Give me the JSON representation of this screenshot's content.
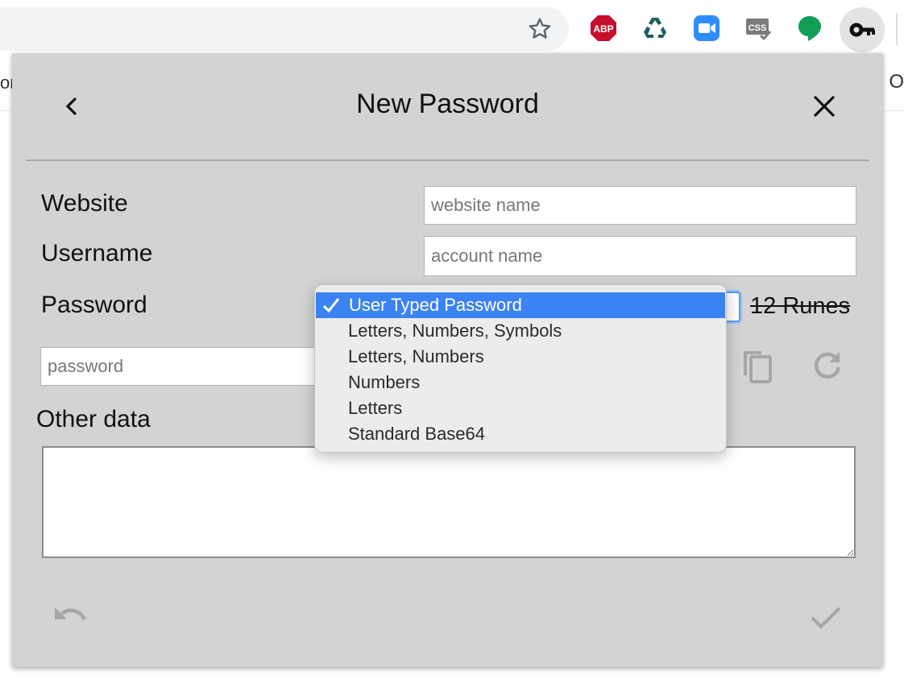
{
  "browser": {
    "extensions": [
      {
        "name": "AdBlock Plus",
        "label": "ABP",
        "icon": "abp-icon"
      },
      {
        "name": "recycle",
        "icon": "recycle-icon"
      },
      {
        "name": "zoom",
        "icon": "zoom-icon"
      },
      {
        "name": "css",
        "label": "CSS",
        "icon": "css-icon"
      },
      {
        "name": "chat",
        "icon": "chat-bubble-icon"
      },
      {
        "name": "key",
        "icon": "key-icon"
      }
    ],
    "page_left_text": "on",
    "page_right_text": "O"
  },
  "dialog": {
    "title": "New Password",
    "website": {
      "label": "Website",
      "placeholder": "website name"
    },
    "username": {
      "label": "Username",
      "placeholder": "account name"
    },
    "password": {
      "label": "Password",
      "placeholder": "password",
      "runes_text": "12 Runes"
    },
    "other": {
      "label": "Other data"
    }
  },
  "dropdown": {
    "selected_index": 0,
    "options": [
      "User Typed Password",
      "Letters, Numbers, Symbols",
      "Letters, Numbers",
      "Numbers",
      "Letters",
      "Standard Base64"
    ]
  },
  "colors": {
    "dialog_bg": "#d3d3d3",
    "selection": "#3b83f2",
    "abp_red": "#c70d2c",
    "zoom_blue": "#2d8cff",
    "chat_green": "#0f9d58"
  }
}
